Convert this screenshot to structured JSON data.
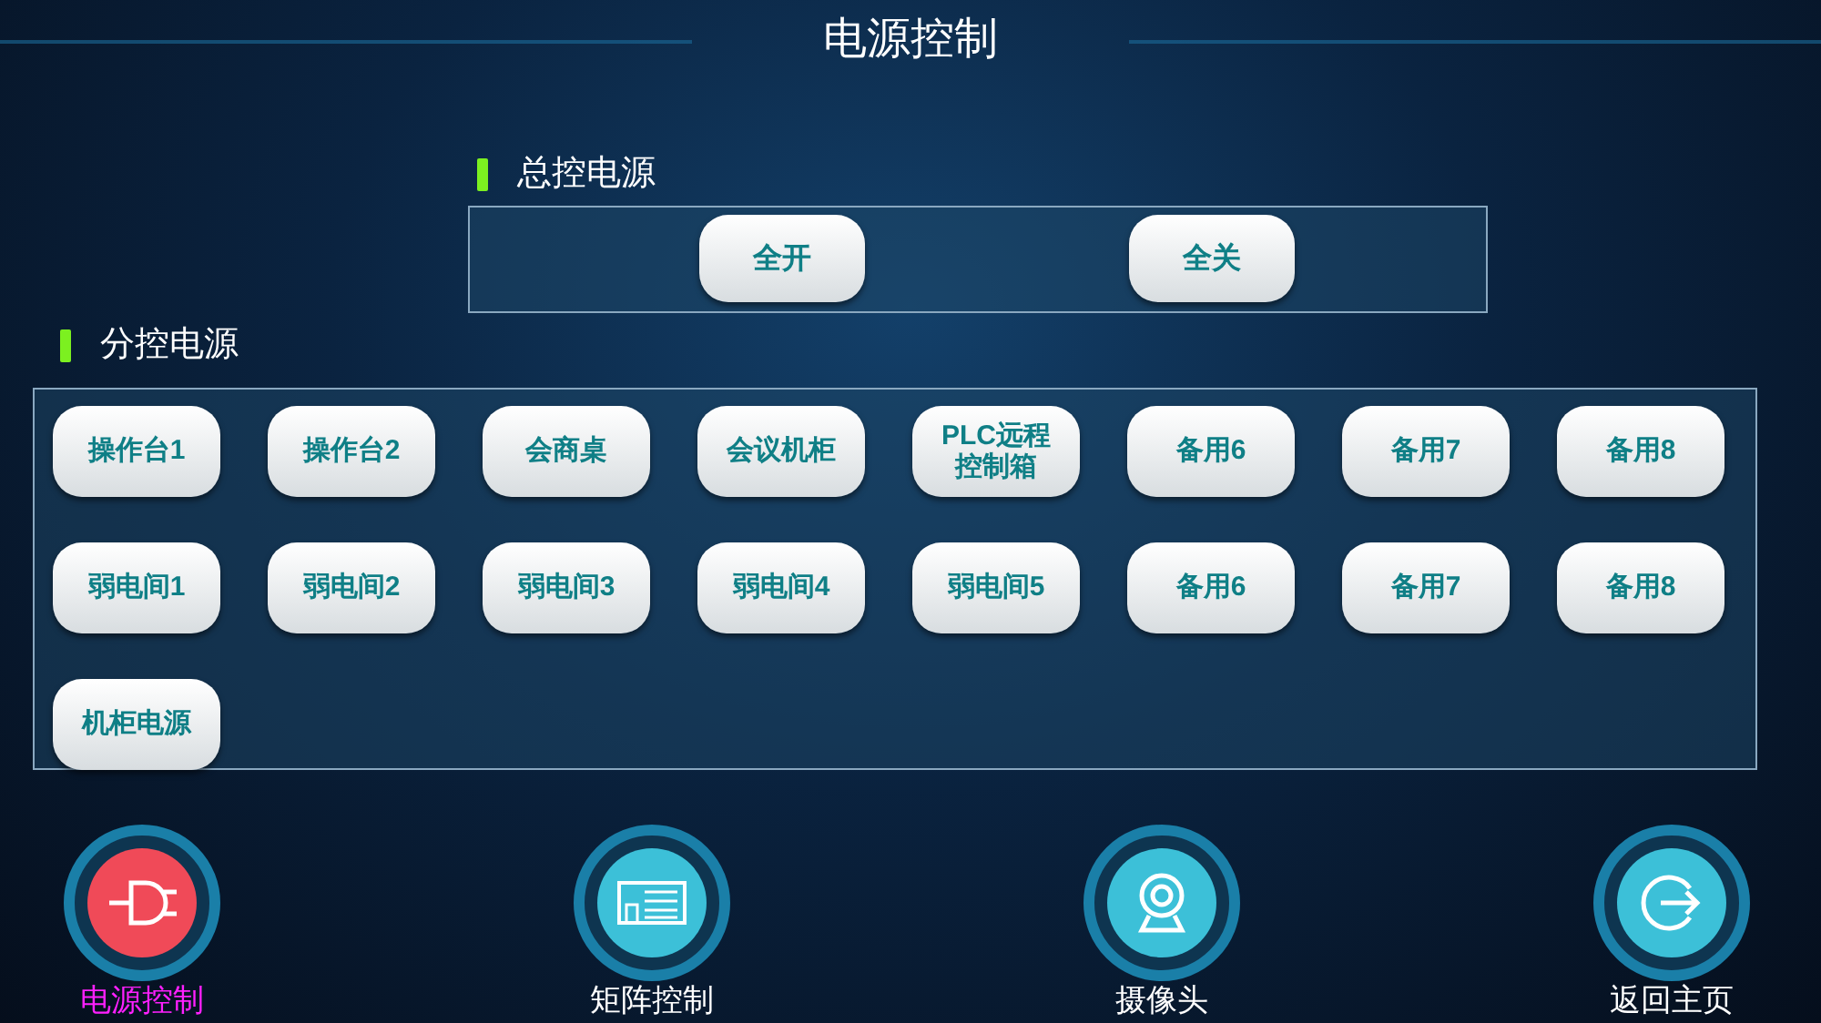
{
  "title": "电源控制",
  "master": {
    "heading": "总控电源",
    "buttons": [
      "全开",
      "全关"
    ]
  },
  "branch": {
    "heading": "分控电源",
    "buttons": [
      "操作台1",
      "操作台2",
      "会商桌",
      "会议机柜",
      "PLC远程控制箱",
      "备用6",
      "备用7",
      "备用8",
      "弱电间1",
      "弱电间2",
      "弱电间3",
      "弱电间4",
      "弱电间5",
      "备用6",
      "备用7",
      "备用8",
      "机柜电源"
    ]
  },
  "nav": [
    {
      "kind": "plug",
      "label": "电源控制",
      "selected": true
    },
    {
      "kind": "matrix",
      "label": "矩阵控制",
      "selected": false
    },
    {
      "kind": "camera",
      "label": "摄像头",
      "selected": false
    },
    {
      "kind": "exit",
      "label": "返回主页",
      "selected": false
    }
  ]
}
